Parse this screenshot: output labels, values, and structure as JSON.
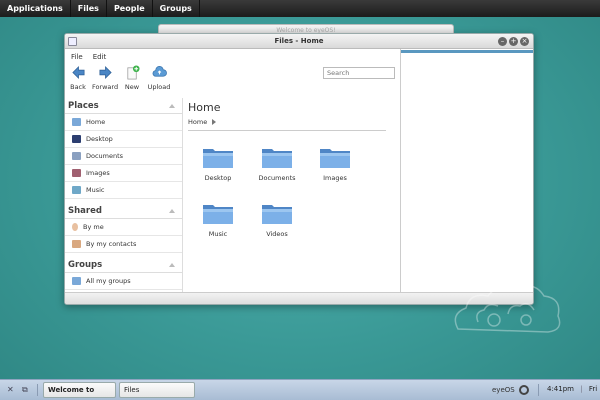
{
  "topbar": {
    "menus": [
      "Applications",
      "Files",
      "People",
      "Groups"
    ]
  },
  "bg_window": {
    "title": "Welcome to eyeOS!"
  },
  "window": {
    "title": "Files - Home",
    "menubar": [
      "File",
      "Edit"
    ],
    "toolbar": {
      "back": "Back",
      "forward": "Forward",
      "new": "New",
      "upload": "Upload"
    },
    "search": {
      "placeholder": "Search"
    }
  },
  "sidebar": {
    "places_title": "Places",
    "places": [
      "Home",
      "Desktop",
      "Documents",
      "Images",
      "Music"
    ],
    "shared_title": "Shared",
    "shared": [
      "By me",
      "By my contacts"
    ],
    "groups_title": "Groups",
    "groups": [
      "All my groups"
    ]
  },
  "content": {
    "heading": "Home",
    "breadcrumb": "Home",
    "folders": [
      "Desktop",
      "Documents",
      "Images",
      "Music",
      "Videos"
    ]
  },
  "taskbar": {
    "tasks": [
      "Welcome to eyeOS!",
      "Files"
    ],
    "brand": "eyeOS",
    "time": "4:41pm",
    "day": "Fri"
  },
  "colors": {
    "desktop": "#3a9996",
    "folder": "#6aa2dc",
    "taskbar": "#b4c6dc"
  }
}
